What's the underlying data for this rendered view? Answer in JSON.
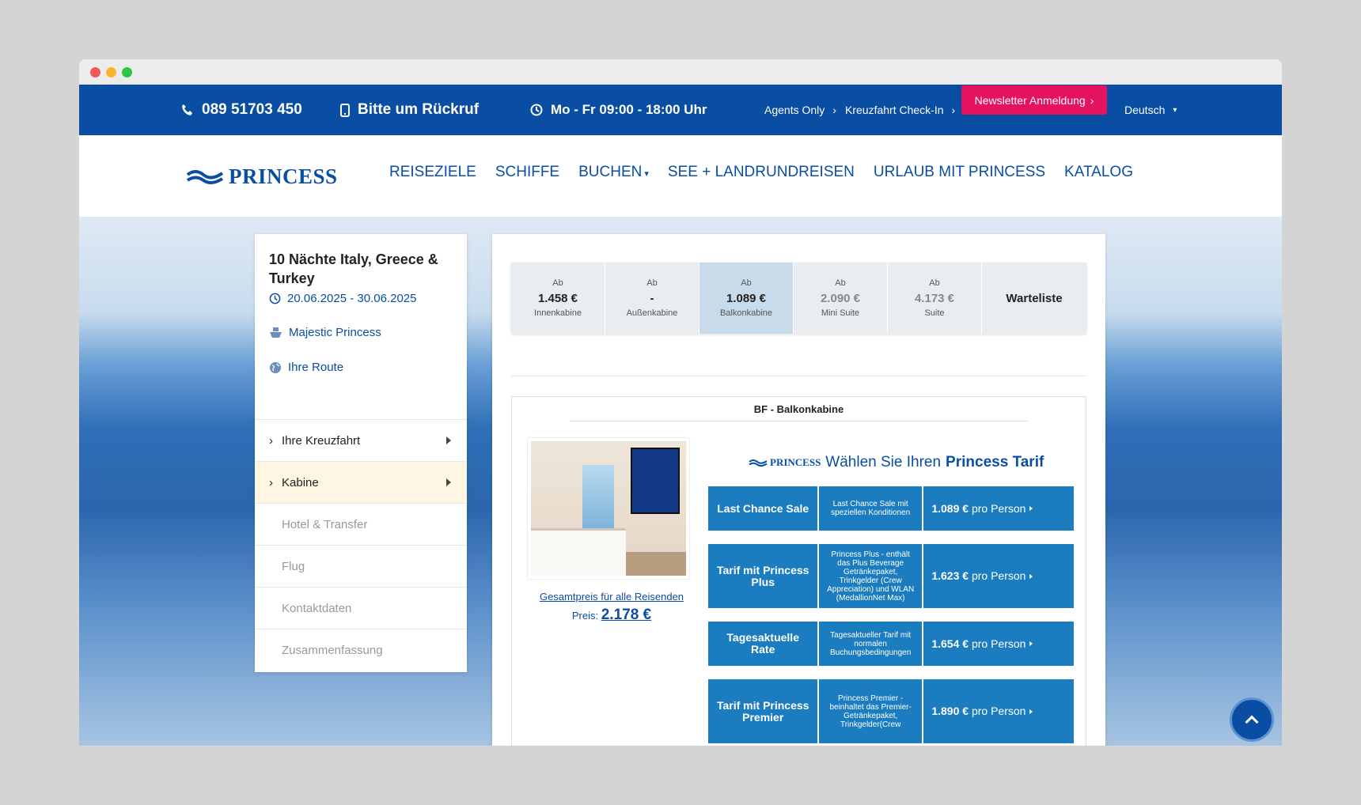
{
  "topbar": {
    "phone": "089 51703 450",
    "callback": "Bitte um Rückruf",
    "hours": "Mo - Fr 09:00 - 18:00 Uhr",
    "agents": "Agents Only",
    "checkin": "Kreuzfahrt Check-In",
    "newsletter": "Newsletter Anmeldung",
    "language": "Deutsch"
  },
  "nav": {
    "logo": "PRINCESS",
    "links": [
      "REISEZIELE",
      "SCHIFFE",
      "BUCHEN",
      "SEE + LANDRUNDREISEN",
      "URLAUB MIT PRINCESS",
      "KATALOG"
    ]
  },
  "sidebar": {
    "title": "10 Nächte Italy, Greece & Turkey",
    "dates": "20.06.2025 - 30.06.2025",
    "ship": "Majestic Princess",
    "route": "Ihre Route",
    "steps": [
      "Ihre Kreuzfahrt",
      "Kabine",
      "Hotel & Transfer",
      "Flug",
      "Kontaktdaten",
      "Zusammenfassung"
    ]
  },
  "prices": {
    "prefix": "Ab",
    "cells": [
      {
        "price": "1.458 €",
        "label": "Innenkabine"
      },
      {
        "price": "-",
        "label": "Außenkabine"
      },
      {
        "price": "1.089 €",
        "label": "Balkonkabine"
      },
      {
        "price": "2.090 €",
        "label": "Mini Suite"
      },
      {
        "price": "4.173 €",
        "label": "Suite"
      }
    ],
    "waitlist": "Warteliste"
  },
  "cabin": {
    "title": "BF - Balkonkabine",
    "total_link": "Gesamtpreis für alle Reisenden",
    "price_label": "Preis:",
    "price_value": "2.178 €"
  },
  "tariff": {
    "logo": "PRINCESS",
    "heading_pre": "Wählen Sie Ihren",
    "heading_bold": "Princess Tarif",
    "rows": [
      {
        "name": "Last Chance Sale",
        "desc": "Last Chance Sale mit speziellen Konditionen",
        "price": "1.089 €",
        "unit": "pro Person"
      },
      {
        "name": "Tarif mit Princess Plus",
        "desc": "Princess Plus - enthält das Plus Beverage Getränkepaket, Trinkgelder (Crew Appreciation) und WLAN (MedallionNet Max)",
        "price": "1.623 €",
        "unit": "pro Person"
      },
      {
        "name": "Tagesaktuelle Rate",
        "desc": "Tagesaktueller Tarif mit normalen Buchungsbedingungen",
        "price": "1.654 €",
        "unit": "pro Person"
      },
      {
        "name": "Tarif mit Princess Premier",
        "desc": "Princess Premier - beinhaltet das Premier-Getränkepaket, Trinkgelder(Crew",
        "price": "1.890 €",
        "unit": "pro Person"
      }
    ]
  },
  "colors": {
    "brand": "#0a4ea3",
    "accent": "#e5125e",
    "tariff": "#1b7dc0"
  }
}
